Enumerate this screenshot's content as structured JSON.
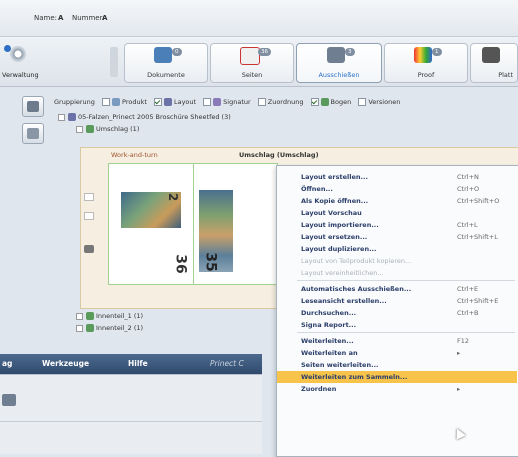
{
  "filters": {
    "name_label": "Name:",
    "name_value": "A",
    "number_label": "Nummer:",
    "number_value": "A"
  },
  "toolbar": {
    "admin_label": "Verwaltung",
    "steps": [
      {
        "label": "Dokumente",
        "count": "0"
      },
      {
        "label": "Seiten",
        "count": "36"
      },
      {
        "label": "Ausschießen",
        "count": "3"
      },
      {
        "label": "Proof",
        "count": "1"
      },
      {
        "label": "Platt",
        "count": ""
      }
    ]
  },
  "options": {
    "grouping": "Gruppierung",
    "produkt": "Produkt",
    "layout": "Layout",
    "signatur": "Signatur",
    "zuordnung": "Zuordnung",
    "bogen": "Bogen",
    "versionen": "Versionen"
  },
  "tree": {
    "root": "05-Falzen_Prinect 2005 Broschüre Sheetfed (3)",
    "umschlag": "Umschlag (1)",
    "innenteil1": "Innenteil_1 (1)",
    "innenteil2": "Innenteil_2 (1)"
  },
  "document": {
    "mode": "Work-and-turn",
    "sheet_title": "Umschlag (Umschlag)",
    "page_left": "36",
    "page_mid": "35",
    "page_top": "2"
  },
  "context_menu": [
    {
      "label": "Layout erstellen...",
      "shortcut": "Ctrl+N",
      "disabled": false
    },
    {
      "label": "Öffnen...",
      "shortcut": "Ctrl+O",
      "disabled": false
    },
    {
      "label": "Als Kopie öffnen...",
      "shortcut": "Ctrl+Shift+O",
      "disabled": false
    },
    {
      "label": "Layout Vorschau",
      "shortcut": "",
      "disabled": false
    },
    {
      "label": "Layout importieren...",
      "shortcut": "Ctrl+L",
      "disabled": false
    },
    {
      "label": "Layout ersetzen...",
      "shortcut": "Ctrl+Shift+L",
      "disabled": false
    },
    {
      "label": "Layout duplizieren...",
      "shortcut": "",
      "disabled": false
    },
    {
      "label": "Layout von Teilprodukt kopieren...",
      "shortcut": "",
      "disabled": true
    },
    {
      "label": "Layout vereinheitlichen...",
      "shortcut": "",
      "disabled": true
    },
    {
      "label": "Automatisches Ausschießen...",
      "shortcut": "Ctrl+E",
      "disabled": false
    },
    {
      "label": "Leseansicht erstellen...",
      "shortcut": "Ctrl+Shift+E",
      "disabled": false
    },
    {
      "label": "Durchsuchen...",
      "shortcut": "Ctrl+B",
      "disabled": false
    },
    {
      "label": "Signa Report...",
      "shortcut": "",
      "disabled": false
    },
    {
      "label": "Weiterleiten...",
      "shortcut": "F12",
      "disabled": false
    },
    {
      "label": "Weiterleiten an",
      "shortcut": "▸",
      "disabled": false
    },
    {
      "label": "Seiten weiterleiten...",
      "shortcut": "",
      "disabled": false
    },
    {
      "label": "Weiterleiten zum Sammeln...",
      "shortcut": "",
      "disabled": false,
      "highlighted": true
    },
    {
      "label": "Zuordnen",
      "shortcut": "▸",
      "disabled": false
    }
  ],
  "menubar": {
    "item_partial": "ag",
    "werkzeuge": "Werkzeuge",
    "hilfe": "Hilfe",
    "app_partial": "Prinect C"
  },
  "colors": {
    "menu_highlight": "#f7c34a",
    "menubar": "#3b5679",
    "accent_blue": "#2e72c8"
  }
}
